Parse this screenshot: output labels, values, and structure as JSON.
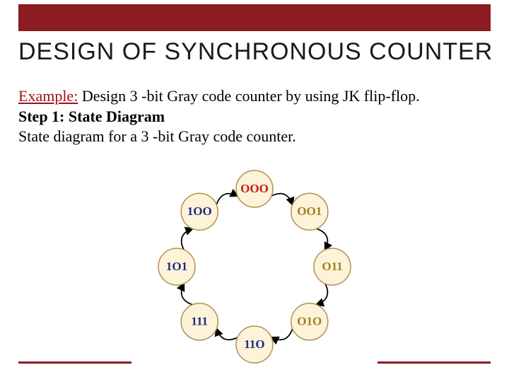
{
  "title": "DESIGN OF SYNCHRONOUS COUNTER",
  "body": {
    "example_label": "Example:",
    "example_text": "  Design 3 -bit Gray code counter by using JK flip-flop.",
    "step_label": "Step 1: State Diagram",
    "step_text": "State diagram for a 3 -bit Gray code counter."
  },
  "chart_data": {
    "type": "state-diagram",
    "title": "3-bit Gray code counter state diagram",
    "states": [
      {
        "label": "000",
        "color": "red"
      },
      {
        "label": "001",
        "color": "gold"
      },
      {
        "label": "011",
        "color": "gold"
      },
      {
        "label": "010",
        "color": "gold"
      },
      {
        "label": "110",
        "color": "blue"
      },
      {
        "label": "111",
        "color": "blue"
      },
      {
        "label": "101",
        "color": "blue"
      },
      {
        "label": "100",
        "color": "blue"
      }
    ],
    "transitions": [
      [
        "000",
        "001"
      ],
      [
        "001",
        "011"
      ],
      [
        "011",
        "010"
      ],
      [
        "010",
        "110"
      ],
      [
        "110",
        "111"
      ],
      [
        "111",
        "101"
      ],
      [
        "101",
        "100"
      ],
      [
        "100",
        "000"
      ]
    ]
  }
}
